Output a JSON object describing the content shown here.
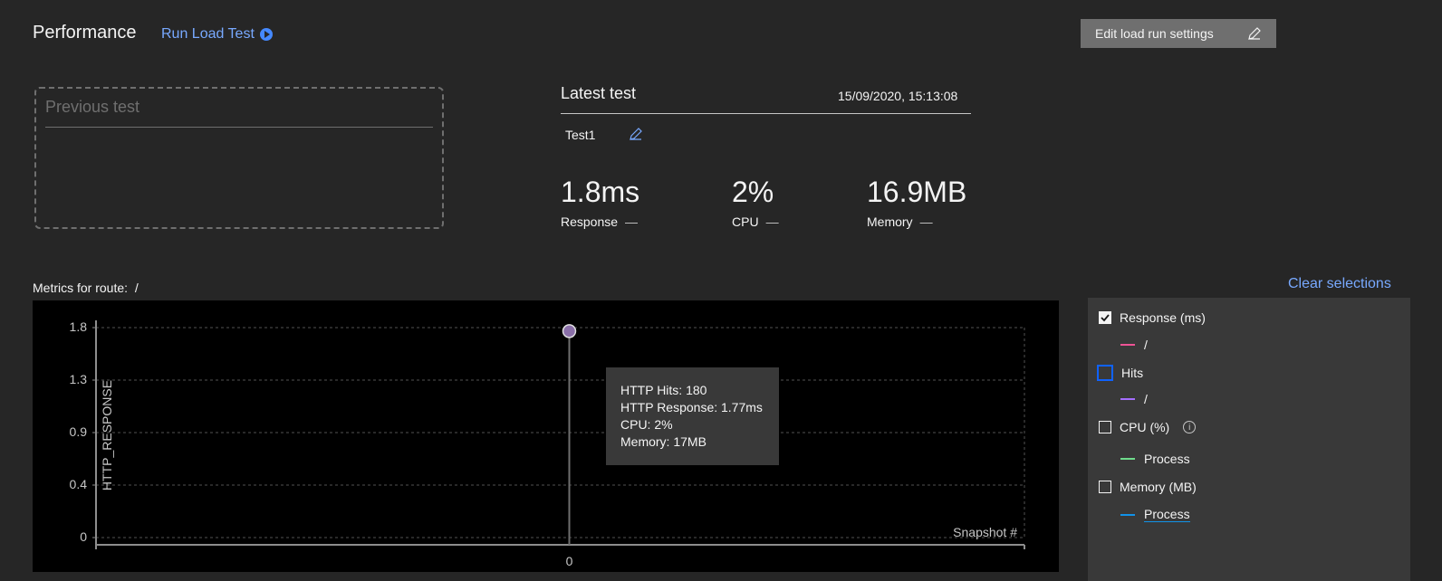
{
  "header": {
    "title": "Performance",
    "run_load_test": "Run Load Test",
    "edit_settings": "Edit load run settings"
  },
  "previous_test": {
    "label": "Previous test"
  },
  "latest_test": {
    "title": "Latest test",
    "date": "15/09/2020, 15:13:08",
    "name": "Test1",
    "metrics": [
      {
        "value": "1.8ms",
        "label": "Response",
        "delta": "—"
      },
      {
        "value": "2%",
        "label": "CPU",
        "delta": "—"
      },
      {
        "value": "16.9MB",
        "label": "Memory",
        "delta": "—"
      }
    ]
  },
  "route": {
    "label": "Metrics for route:",
    "value": "/"
  },
  "clear_selections": "Clear selections",
  "chart_data": {
    "type": "line",
    "ylabel": "HTTP_RESPONSE",
    "xlabel": "Snapshot #",
    "y_ticks": [
      "1.8",
      "1.3",
      "0.9",
      "0.4",
      "0"
    ],
    "x_ticks": [
      "0"
    ],
    "ylim": [
      0,
      1.8
    ],
    "series": [
      {
        "name": "/",
        "x": [
          0
        ],
        "y": [
          1.77
        ]
      }
    ],
    "tooltip": [
      "HTTP Hits: 180",
      "HTTP Response: 1.77ms",
      "CPU: 2%",
      "Memory: 17MB"
    ]
  },
  "legend": {
    "items": [
      {
        "label": "Response (ms)",
        "checked": true,
        "sub": "/",
        "color": "#ee5396"
      },
      {
        "label": "Hits",
        "checked": false,
        "sub": "/",
        "color": "#a56eff"
      },
      {
        "label": "CPU (%)",
        "checked": false,
        "sub": "Process",
        "color": "#6fdc8c"
      },
      {
        "label": "Memory (MB)",
        "checked": false,
        "sub": "Process",
        "color": "#1192e8"
      }
    ]
  }
}
